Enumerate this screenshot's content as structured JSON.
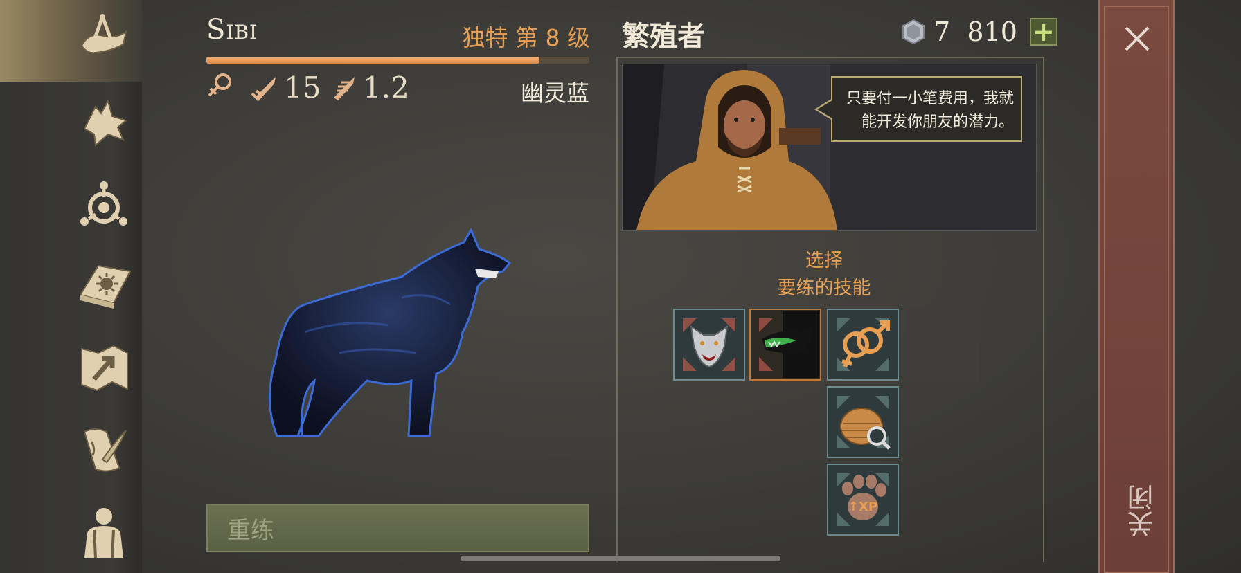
{
  "pet": {
    "name": "Sibi",
    "rank": "独特 第 8 级",
    "xp_fraction": 0.87,
    "gender_icon": "female-icon",
    "attack_icon": "sword-icon",
    "attack": "15",
    "speed_icon": "dagger-speed-icon",
    "speed": "1.2",
    "coat": "幽灵蓝"
  },
  "actions": {
    "retrain_label": "重练"
  },
  "breeder": {
    "title": "繁殖者",
    "currency_icon": "silver-gem-icon",
    "currency_value": "7  810",
    "add_label": "+",
    "dialog": "只要付一小笔费用，我就能开发你朋友的潜力。"
  },
  "skills": {
    "prompt_line1": "选择",
    "prompt_line2": "要练的技能",
    "items": [
      {
        "icon": "wolf-head-icon",
        "selected": false
      },
      {
        "icon": "green-wolf-fang-icon",
        "selected": true
      },
      {
        "icon": "gender-symbols-icon",
        "selected": false
      },
      {
        "icon": "basket-search-icon",
        "selected": false
      },
      {
        "icon": "paw-xp-icon",
        "selected": false
      }
    ]
  },
  "sidebar": {
    "items": [
      "horn-hand-icon",
      "wolf-icon",
      "compass-icon",
      "sun-book-icon",
      "map-arrow-icon",
      "scroll-quill-icon",
      "character-icon"
    ]
  },
  "close": {
    "label": "关闭",
    "icon": "close-x-icon"
  },
  "colors": {
    "accent": "#e7a053",
    "retrain_bg": "#5f6547",
    "close_bg": "#6f4038"
  }
}
